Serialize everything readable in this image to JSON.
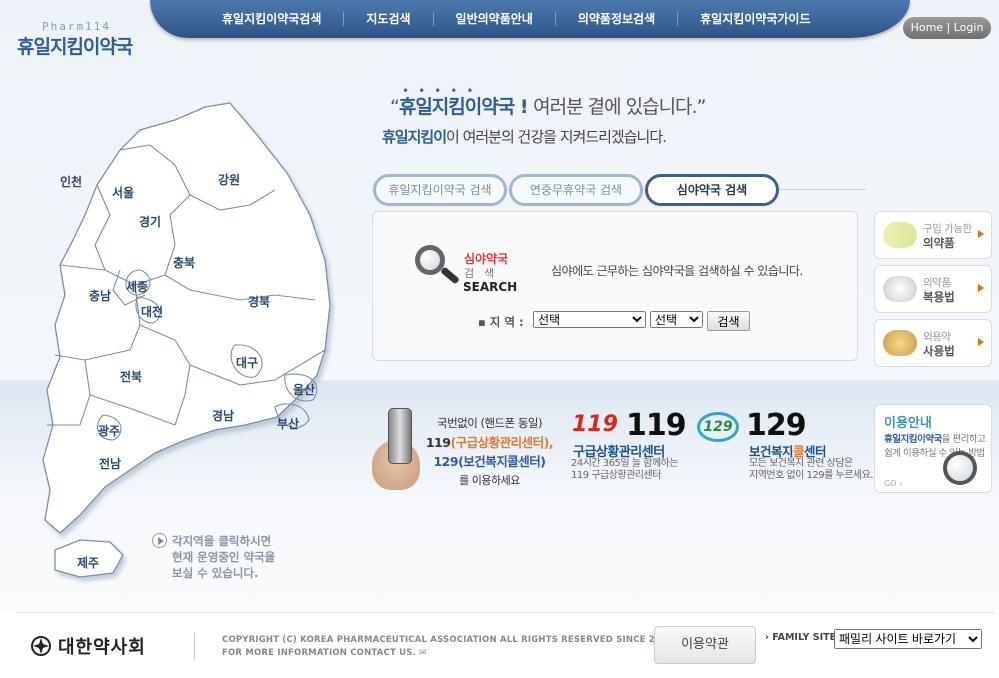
{
  "header": {
    "logo_sub": "Pharm114",
    "logo": "휴일지킴이약국",
    "nav": [
      "휴일지킴이약국검색",
      "지도검색",
      "일반의약품안내",
      "의약품정보검색",
      "휴일지킴이약국가이드"
    ],
    "home_login": "Home | Login"
  },
  "map": {
    "regions": [
      "인천",
      "서울",
      "경기",
      "강원",
      "충북",
      "세종",
      "충남",
      "대전",
      "경북",
      "대구",
      "전북",
      "울산",
      "경남",
      "부산",
      "광주",
      "전남",
      "제주"
    ],
    "hint_lines": [
      "각지역을 클릭하시면",
      "현재 운영중인 약국을",
      "보실 수 있습니다."
    ]
  },
  "slogan": {
    "line1_open": "“",
    "line1_brand": "휴일지킴이약국",
    "line1_bang": " ! ",
    "line1_rest": "여러분 곁에 있습니다.”",
    "line2_brand": "휴일지킴이",
    "line2_rest": "이 여러분의 건강을 지켜드리겠습니다."
  },
  "tabs": [
    "휴일지킴이약국 검색",
    "연중무휴약국 검색",
    "심야약국 검색"
  ],
  "search": {
    "title_red": "심야약국",
    "title_grey": "검색",
    "title_en": "SEARCH",
    "description": "심야에도 근무하는 심야약국을 검색하실 수 있습니다.",
    "region_label": "▪ 지 역 :",
    "select1": "선택",
    "select2": "선택",
    "button": "검색"
  },
  "side_boxes": [
    {
      "line1": "구입 가능한",
      "line2": "의약품"
    },
    {
      "line1": "의약품",
      "line2": "복용법"
    },
    {
      "line1": "외용약",
      "line2": "사용법"
    }
  ],
  "info": {
    "a_line1": "국번없이 (핸드폰 동일)",
    "a_line2_num": "119",
    "a_line2_txt": "(구급상황관리센터),",
    "a_line3": "129(보건복지콜센터)",
    "a_line4": "를 이용하세요",
    "logo119": "119",
    "num119": "119",
    "title119": "구급상황관리센터",
    "desc119_1": "24시간 365일 늘 함께하는",
    "desc119_2": "119 구급상황관리센터",
    "logo129": "129",
    "num129": "129",
    "title129_a": "보건복지",
    "title129_b": "콜",
    "title129_c": "센터",
    "desc129_1": "모든 보건복지 관련 상담은",
    "desc129_2": "지역번호 없이 129를 누르세요."
  },
  "guide": {
    "title": "이용안내",
    "desc_brand": "휴일지킴이약국",
    "desc_rest": "을 편리하고 쉽게 이용하실 수 있는 방법",
    "go": "GO ›"
  },
  "footer": {
    "org": "대한약사회",
    "copy1": "COPYRIGHT (C) KOREA PHARMACEUTICAL ASSOCIATION ALL RIGHTS RESERVED SINCE 2005",
    "copy2": "FOR MORE INFORMATION CONTACT US.",
    "terms": "이용약관",
    "family_label": "› FAMILY SITE",
    "family_select": "패밀리 사이트 바로가기"
  }
}
